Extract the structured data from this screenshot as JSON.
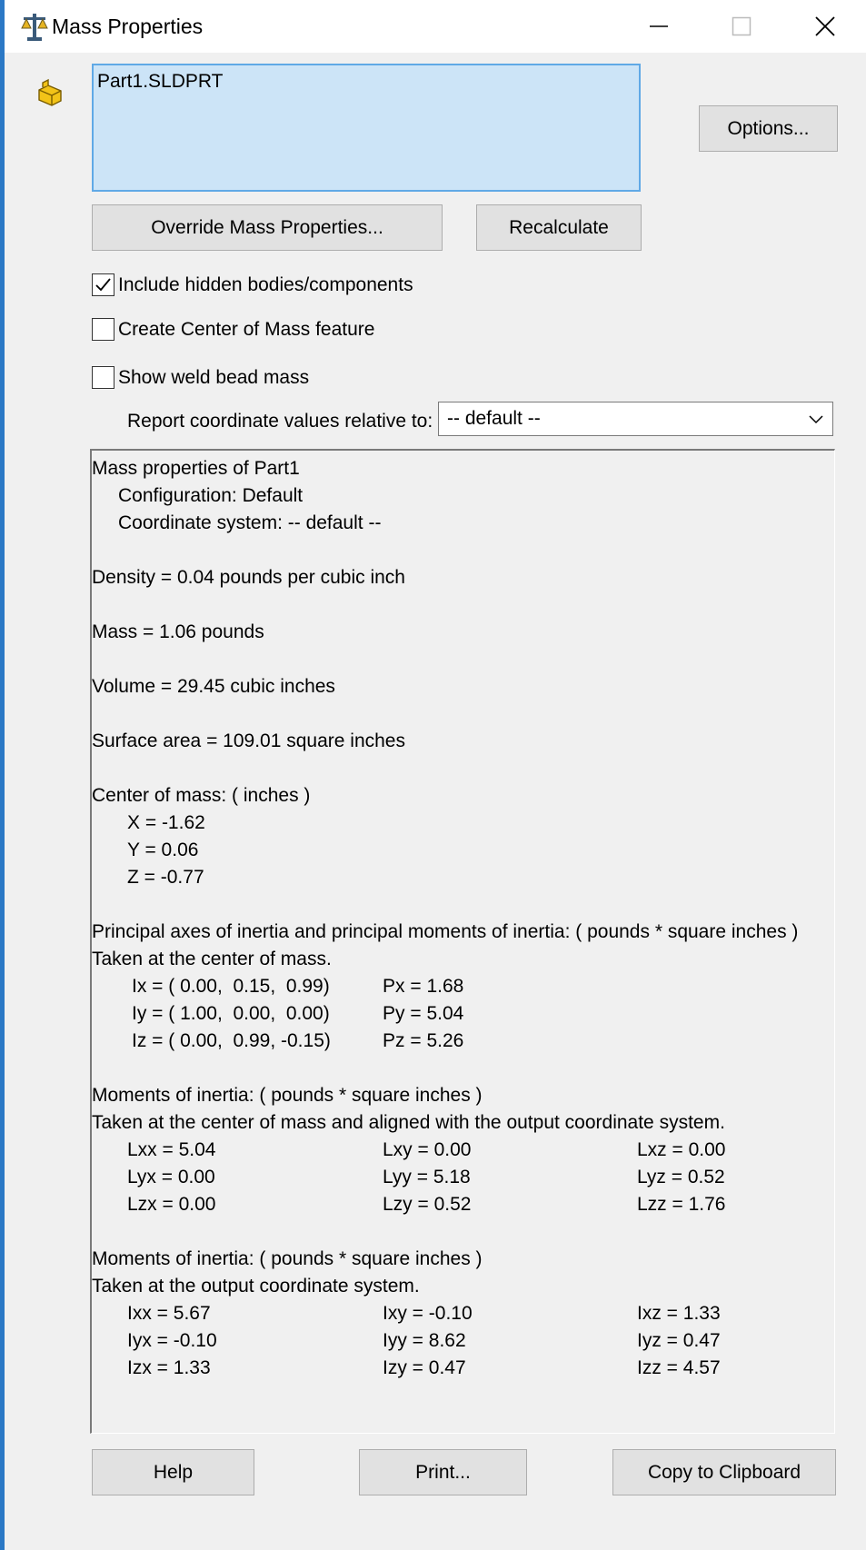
{
  "window": {
    "title": "Mass Properties",
    "icon": "scale-icon",
    "controls": [
      "minimize-icon",
      "maximize-icon",
      "close-icon"
    ]
  },
  "selection": {
    "items": [
      "Part1.SLDPRT"
    ],
    "icon": "part-icon"
  },
  "buttons": {
    "options": "Options...",
    "override": "Override Mass Properties...",
    "recalculate": "Recalculate",
    "help": "Help",
    "print": "Print...",
    "copy": "Copy to Clipboard"
  },
  "checkboxes": [
    {
      "label": "Include hidden bodies/components",
      "checked": true
    },
    {
      "label": "Create Center of Mass feature",
      "checked": false
    },
    {
      "label": "Show weld bead mass",
      "checked": false
    }
  ],
  "report": {
    "label": "Report coordinate values relative to:",
    "selected": "-- default --"
  },
  "results": {
    "header": "Mass properties of Part1",
    "configuration": "Configuration: Default",
    "coordinate_system": "Coordinate system: -- default --",
    "density": "Density = 0.04 pounds per cubic inch",
    "mass": "Mass = 1.06 pounds",
    "volume": "Volume = 29.45 cubic inches",
    "surface_area": "Surface area = 109.01 square inches",
    "com_header": "Center of mass: ( inches )",
    "com": [
      "X = -1.62",
      "Y = 0.06",
      "Z = -0.77"
    ],
    "principal_header": "Principal axes of inertia and principal moments of inertia: ( pounds * square inches )",
    "principal_sub": "Taken at the center of mass.",
    "principal_axes": [
      "Ix = ( 0.00,  0.15,  0.99)",
      "Iy = ( 1.00,  0.00,  0.00)",
      "Iz = ( 0.00,  0.99, -0.15)"
    ],
    "principal_moments": [
      "Px = 1.68",
      "Py = 5.04",
      "Pz = 5.26"
    ],
    "moi_com_header": "Moments of inertia: ( pounds * square inches )",
    "moi_com_sub": "Taken at the center of mass and aligned with the output coordinate system.",
    "moi_com": [
      [
        "Lxx = 5.04",
        "Lxy = 0.00",
        "Lxz = 0.00"
      ],
      [
        "Lyx = 0.00",
        "Lyy = 5.18",
        "Lyz = 0.52"
      ],
      [
        "Lzx = 0.00",
        "Lzy = 0.52",
        "Lzz = 1.76"
      ]
    ],
    "moi_out_header": "Moments of inertia: ( pounds * square inches )",
    "moi_out_sub": "Taken at the output coordinate system.",
    "moi_out": [
      [
        "Ixx = 5.67",
        "Ixy = -0.10",
        "Ixz = 1.33"
      ],
      [
        "Iyx = -0.10",
        "Iyy = 8.62",
        "Iyz = 0.47"
      ],
      [
        "Izx = 1.33",
        "Izy = 0.47",
        "Izz = 4.57"
      ]
    ]
  }
}
